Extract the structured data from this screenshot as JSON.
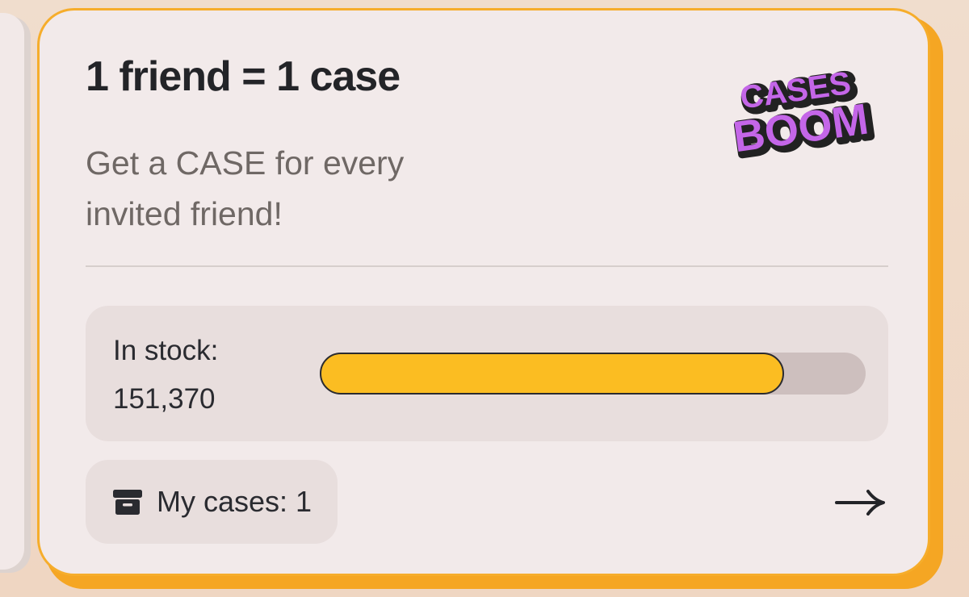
{
  "promo": {
    "title": "1 friend = 1 case",
    "subtitle": "Get a CASE for every invited friend!",
    "logo": {
      "line1": "CASES",
      "line2": "BOOM",
      "color": "#c466e8"
    },
    "stock": {
      "label": "In stock:",
      "value": "151,370",
      "progress_fraction": 0.85
    },
    "my_cases": {
      "label": "My cases: 1",
      "icon": "archive-box-icon"
    },
    "arrow_icon": "arrow-right-icon"
  },
  "colors": {
    "accent": "#f6ad2b",
    "progress_fill": "#fbbd22",
    "text_dark": "#232428",
    "text_muted": "#6f6865"
  }
}
